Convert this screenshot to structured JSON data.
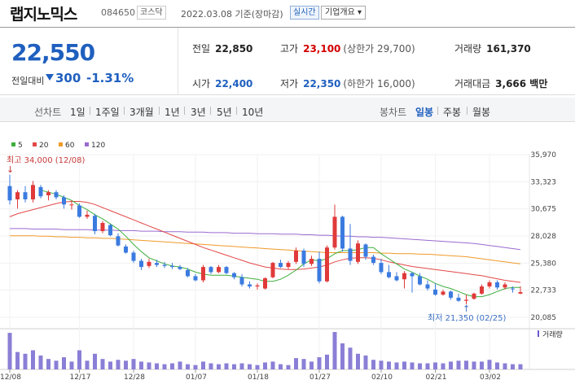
{
  "header": {
    "title": "랩지노믹스",
    "code": "084650",
    "market_badge": "코스닥",
    "date_text": "2022.03.08 기준(장마감)",
    "realtime_badge": "실시간",
    "company_button": "기업개요 ▾"
  },
  "summary": {
    "price": "22,550",
    "change_label": "전일대비",
    "change_value": "300",
    "change_percent": "-1.31%",
    "prev_label": "전일",
    "prev_value": "22,850",
    "high_label": "고가",
    "high_value": "23,100",
    "upper_limit": "(상한가 29,700)",
    "volume_label": "거래량",
    "volume_value": "161,370",
    "open_label": "시가",
    "open_value": "22,400",
    "low_label": "저가",
    "low_value": "22,350",
    "lower_limit": "(하한가 16,000)",
    "amount_label": "거래대금",
    "amount_value": "3,666 백만"
  },
  "periods": {
    "line_label": "선차트",
    "line_items": [
      "1일",
      "1주일",
      "3개월",
      "1년",
      "3년",
      "5년",
      "10년"
    ],
    "candle_label": "봉차트",
    "candle_items": [
      "일봉",
      "주봉",
      "월봉"
    ],
    "selected": "일봉"
  },
  "colors": {
    "up": "#e03a3a",
    "down": "#3b7be0",
    "ma5": "#3fae3f",
    "ma20": "#e34848",
    "ma60": "#f09a2a",
    "ma120": "#9a6ad0"
  },
  "chart_data": {
    "type": "candlestick",
    "legend": [
      "5",
      "20",
      "60",
      "120"
    ],
    "y_ticks": [
      "35,970",
      "33,323",
      "30,675",
      "28,028",
      "25,380",
      "22,733",
      "20,085"
    ],
    "ylim": [
      20085,
      35970
    ],
    "x_ticks": [
      "12/08",
      "12/17",
      "12/28",
      "01/07",
      "01/18",
      "01/27",
      "02/10",
      "02/21",
      "03/02"
    ],
    "x_tick_index": [
      0,
      9,
      16,
      24,
      32,
      40,
      48,
      55,
      62
    ],
    "high_annotation": "최고 34,000 (12/08)",
    "high_index": 0,
    "low_annotation": "최저 21,350 (02/25)",
    "low_index": 59,
    "volume_label": "거래량",
    "candles": [
      [
        32900,
        34000,
        31100,
        31500,
        42
      ],
      [
        31600,
        32500,
        30700,
        32300,
        20
      ],
      [
        32300,
        32900,
        31300,
        31600,
        18
      ],
      [
        31600,
        33400,
        31300,
        33000,
        22
      ],
      [
        32800,
        33000,
        31700,
        31900,
        16
      ],
      [
        32000,
        32500,
        31500,
        32300,
        12
      ],
      [
        32300,
        32500,
        31600,
        31800,
        10
      ],
      [
        31800,
        32000,
        30700,
        31100,
        14
      ],
      [
        31100,
        31500,
        30600,
        31100,
        9
      ],
      [
        31000,
        31200,
        29800,
        29900,
        22
      ],
      [
        29900,
        30500,
        29700,
        30100,
        10
      ],
      [
        30000,
        30200,
        28200,
        28500,
        18
      ],
      [
        28500,
        29500,
        28300,
        29300,
        12
      ],
      [
        29100,
        29200,
        28000,
        28100,
        9
      ],
      [
        28000,
        28300,
        27000,
        27100,
        11
      ],
      [
        27000,
        27200,
        26300,
        26400,
        10
      ],
      [
        26400,
        26600,
        25400,
        25600,
        12
      ],
      [
        25600,
        25800,
        24700,
        25000,
        9
      ],
      [
        25100,
        25800,
        24900,
        25500,
        8
      ],
      [
        25400,
        25700,
        25000,
        25200,
        7
      ],
      [
        25200,
        25500,
        24900,
        25100,
        6
      ],
      [
        25100,
        25400,
        24800,
        25000,
        7
      ],
      [
        25000,
        25200,
        24700,
        24800,
        9
      ],
      [
        24700,
        24900,
        24000,
        24100,
        6
      ],
      [
        24100,
        24300,
        23600,
        23700,
        5
      ],
      [
        23700,
        25200,
        23500,
        25000,
        9
      ],
      [
        25000,
        25100,
        24300,
        24500,
        7
      ],
      [
        24500,
        25200,
        24400,
        25000,
        6
      ],
      [
        25000,
        25100,
        24300,
        24400,
        7
      ],
      [
        24400,
        24500,
        23800,
        24000,
        6
      ],
      [
        24000,
        24300,
        23100,
        23300,
        7
      ],
      [
        23300,
        23600,
        22900,
        23100,
        6
      ],
      [
        23100,
        23400,
        22800,
        23200,
        5
      ],
      [
        22900,
        24000,
        22800,
        23900,
        8
      ],
      [
        24000,
        25500,
        23900,
        25400,
        9
      ],
      [
        25400,
        25700,
        24900,
        25000,
        6
      ],
      [
        25000,
        25600,
        24800,
        25400,
        5
      ],
      [
        25500,
        26900,
        25300,
        26600,
        13
      ],
      [
        26600,
        26800,
        25000,
        25300,
        12
      ],
      [
        25300,
        26100,
        25100,
        25800,
        9
      ],
      [
        25800,
        26500,
        23400,
        23600,
        14
      ],
      [
        23600,
        27100,
        23500,
        26900,
        17
      ],
      [
        26900,
        31100,
        26700,
        29900,
        43
      ],
      [
        29900,
        30000,
        26500,
        26800,
        30
      ],
      [
        26800,
        29200,
        25200,
        25600,
        25
      ],
      [
        25500,
        27600,
        25300,
        27300,
        18
      ],
      [
        27200,
        27300,
        25700,
        26000,
        16
      ],
      [
        26000,
        26200,
        25200,
        25400,
        11
      ],
      [
        25400,
        25800,
        24300,
        24500,
        10
      ],
      [
        24500,
        25200,
        23900,
        24000,
        9
      ],
      [
        24100,
        24500,
        23600,
        23700,
        8
      ],
      [
        23800,
        24600,
        22900,
        24400,
        9
      ],
      [
        24400,
        24500,
        22500,
        24100,
        8
      ],
      [
        24100,
        24400,
        23200,
        23300,
        7
      ],
      [
        23300,
        23700,
        22700,
        22900,
        7
      ],
      [
        22800,
        23400,
        22200,
        22300,
        8
      ],
      [
        22300,
        22800,
        22200,
        22600,
        7
      ],
      [
        22600,
        22700,
        21800,
        22000,
        9
      ],
      [
        22000,
        22400,
        21600,
        21700,
        10
      ],
      [
        21700,
        22300,
        21350,
        21800,
        10
      ],
      [
        21900,
        22500,
        21800,
        22400,
        9
      ],
      [
        22400,
        23300,
        22300,
        23100,
        9
      ],
      [
        23100,
        23700,
        22900,
        23500,
        11
      ],
      [
        23500,
        23700,
        22800,
        23000,
        8
      ],
      [
        23000,
        23500,
        22800,
        23300,
        7
      ],
      [
        22900,
        23100,
        22500,
        22850,
        6
      ],
      [
        22400,
        23100,
        22350,
        22550,
        6
      ]
    ],
    "ma": {
      "5": [
        null,
        null,
        null,
        null,
        32500,
        32300,
        32100,
        31800,
        31500,
        31000,
        30600,
        30100,
        29700,
        29200,
        28700,
        28000,
        27200,
        26500,
        25900,
        25600,
        25300,
        25100,
        25000,
        24800,
        24500,
        24300,
        24200,
        24200,
        24200,
        24100,
        24000,
        23900,
        23800,
        23600,
        23600,
        23800,
        24200,
        24700,
        25300,
        25700,
        25600,
        25800,
        26300,
        26600,
        26600,
        26700,
        26900,
        26900,
        26300,
        25800,
        25300,
        24800,
        24500,
        24100,
        23800,
        23400,
        23100,
        22900,
        22600,
        22300,
        22100,
        22100,
        22300,
        22600,
        22900,
        23000,
        23000
      ],
      "20": [
        29900,
        30200,
        30400,
        30600,
        30800,
        31000,
        31200,
        31350,
        31400,
        31400,
        31300,
        31100,
        30800,
        30500,
        30200,
        29900,
        29600,
        29300,
        29000,
        28700,
        28400,
        28100,
        27800,
        27500,
        27200,
        26900,
        26650,
        26400,
        26150,
        25900,
        25650,
        25400,
        25200,
        25000,
        24900,
        24800,
        24750,
        24750,
        24800,
        24900,
        25000,
        25200,
        25500,
        25700,
        25850,
        25900,
        25900,
        25850,
        25700,
        25500,
        25350,
        25200,
        25050,
        24950,
        24850,
        24750,
        24650,
        24550,
        24450,
        24350,
        24250,
        24150,
        24000,
        23850,
        23700,
        23600,
        23500
      ],
      "60": [
        28050,
        28050,
        28050,
        28050,
        28000,
        28000,
        27950,
        27950,
        27900,
        27900,
        27850,
        27850,
        27800,
        27800,
        27750,
        27700,
        27650,
        27600,
        27550,
        27500,
        27450,
        27400,
        27350,
        27300,
        27250,
        27200,
        27150,
        27100,
        27050,
        27000,
        26950,
        26900,
        26850,
        26800,
        26750,
        26700,
        26650,
        26600,
        26550,
        26500,
        26450,
        26400,
        26400,
        26400,
        26400,
        26400,
        26400,
        26400,
        26350,
        26350,
        26300,
        26300,
        26300,
        26250,
        26250,
        26200,
        26150,
        26100,
        26050,
        26000,
        25900,
        25800,
        25700,
        25600,
        25500,
        25400,
        25300
      ],
      "120": [
        28750,
        28750,
        28750,
        28700,
        28700,
        28700,
        28700,
        28650,
        28650,
        28650,
        28650,
        28600,
        28600,
        28600,
        28550,
        28550,
        28550,
        28500,
        28500,
        28500,
        28450,
        28450,
        28450,
        28400,
        28400,
        28400,
        28350,
        28350,
        28350,
        28300,
        28300,
        28300,
        28250,
        28250,
        28250,
        28200,
        28200,
        28200,
        28150,
        28150,
        28100,
        28100,
        28050,
        28000,
        28000,
        27950,
        27950,
        27900,
        27900,
        27850,
        27800,
        27750,
        27700,
        27650,
        27600,
        27550,
        27500,
        27450,
        27400,
        27350,
        27300,
        27200,
        27100,
        27000,
        26900,
        26800,
        26700
      ]
    }
  }
}
